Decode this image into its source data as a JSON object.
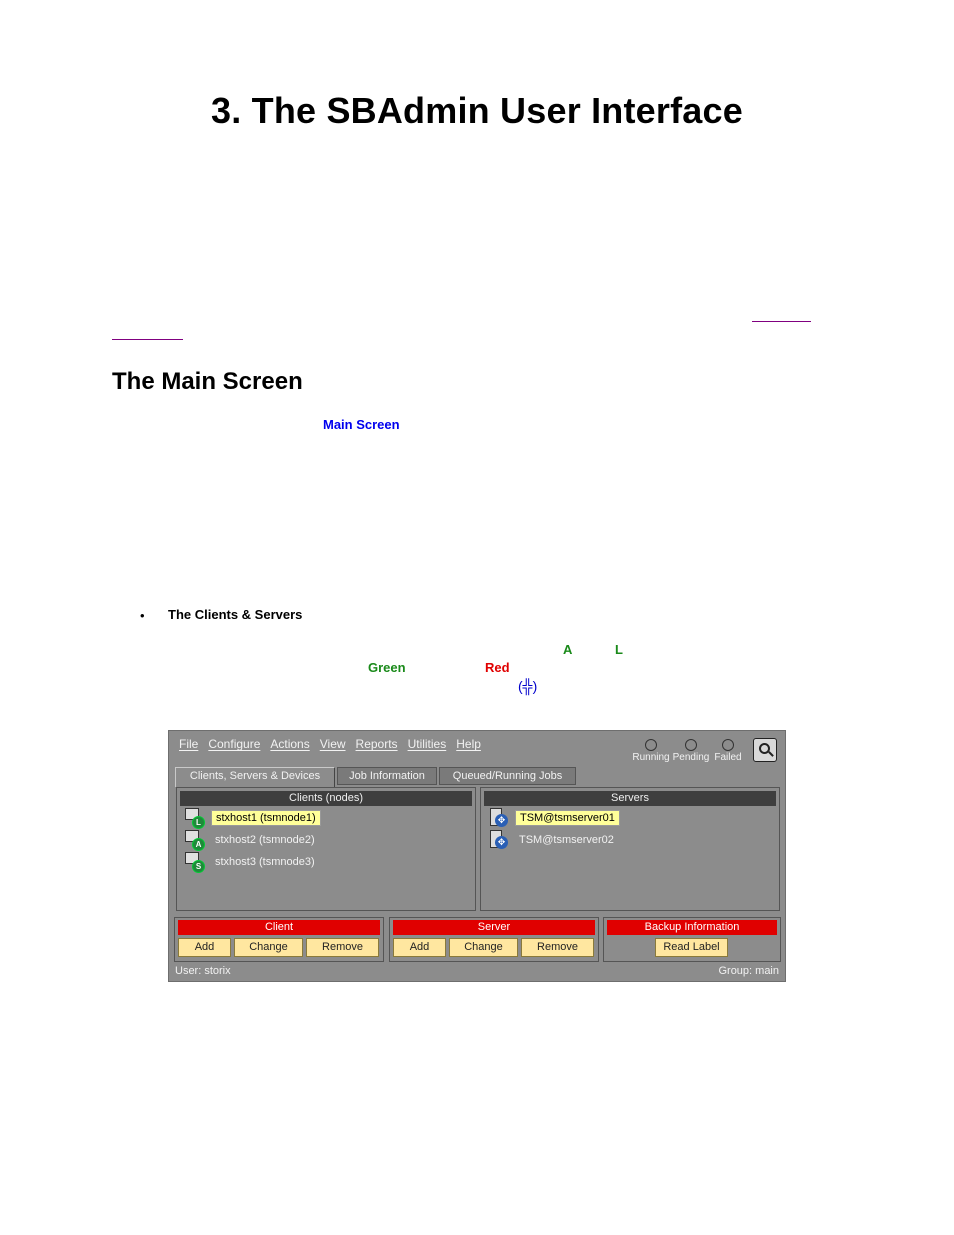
{
  "page": {
    "title": "3. The SBAdmin User Interface",
    "section_heading": "The Main Screen",
    "main_screen_link": "Main Screen",
    "bullet_symbol": "•",
    "bullet_title": "The Clients & Servers",
    "color_words": {
      "a": "A",
      "l": "L",
      "green": "Green",
      "red": "Red",
      "symbol": "(╬)"
    },
    "colors": {
      "link": "#0000ee",
      "visited": "#800080",
      "green": "#1a8a1a",
      "red": "#e00000"
    }
  },
  "app": {
    "menu": [
      "File",
      "Configure",
      "Actions",
      "View",
      "Reports",
      "Utilities",
      "Help"
    ],
    "status": [
      "Running",
      "Pending",
      "Failed"
    ],
    "lookup_icon": "magnifier-icon",
    "tabs": [
      "Clients, Servers & Devices",
      "Job Information",
      "Queued/Running Jobs"
    ],
    "clients_title": "Clients (nodes)",
    "clients": [
      {
        "name": "stxhost1 (tsmnode1)",
        "badge": "L"
      },
      {
        "name": "stxhost2 (tsmnode2)",
        "badge": "A"
      },
      {
        "name": "stxhost3 (tsmnode3)",
        "badge": "S"
      }
    ],
    "servers_title": "Servers",
    "servers": [
      "TSM@tsmserver01",
      "TSM@tsmserver02"
    ],
    "client_group": {
      "title": "Client",
      "add": "Add",
      "change": "Change",
      "remove": "Remove"
    },
    "server_group": {
      "title": "Server",
      "add": "Add",
      "change": "Change",
      "remove": "Remove"
    },
    "backup_group": {
      "title": "Backup Information",
      "read_label": "Read Label"
    },
    "footer_user": "User:  storix",
    "footer_group": "Group: main"
  }
}
